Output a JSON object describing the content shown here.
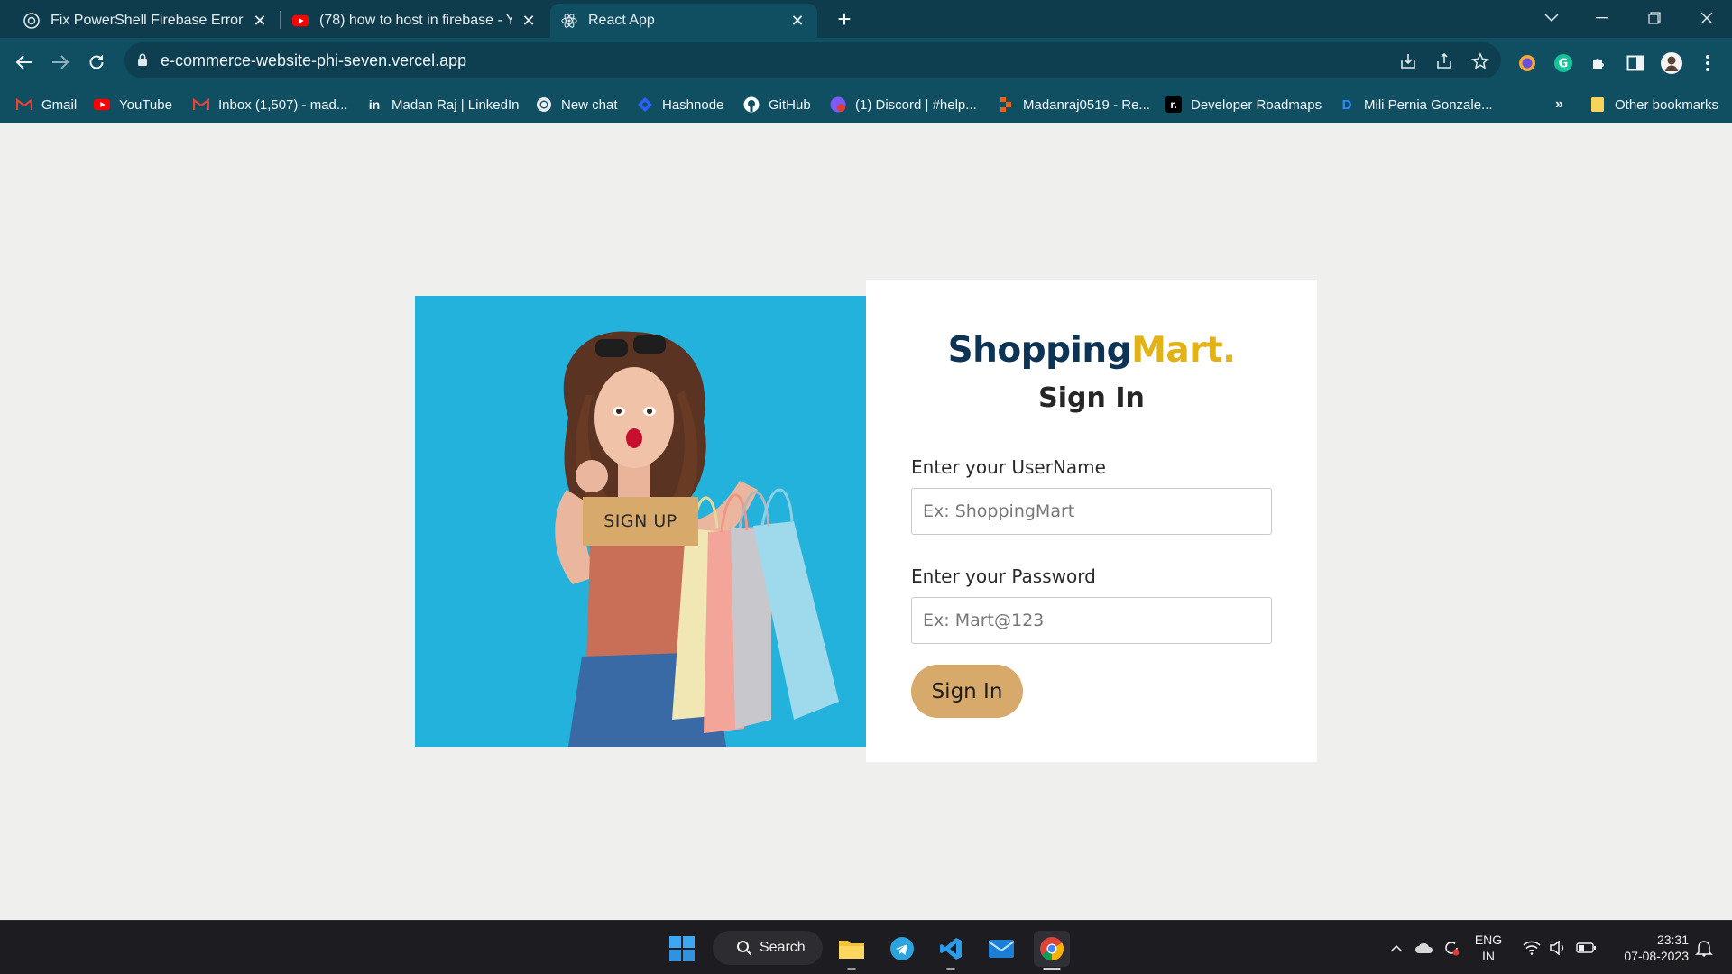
{
  "browser": {
    "tabs": [
      {
        "title": "Fix PowerShell Firebase Error",
        "icon": "chatgpt-icon"
      },
      {
        "title": "(78) how to host in firebase - YouTube",
        "icon": "youtube-icon"
      },
      {
        "title": "React App",
        "icon": "react-icon"
      }
    ],
    "url": "e-commerce-website-phi-seven.vercel.app",
    "bookmarks": [
      {
        "label": "Gmail",
        "icon": "gmail-icon"
      },
      {
        "label": "YouTube",
        "icon": "youtube-icon"
      },
      {
        "label": "Inbox (1,507) - mad...",
        "icon": "gmail-icon"
      },
      {
        "label": "Madan Raj | LinkedIn",
        "icon": "linkedin-icon"
      },
      {
        "label": "New chat",
        "icon": "chatgpt-icon"
      },
      {
        "label": "Hashnode",
        "icon": "hashnode-icon"
      },
      {
        "label": "GitHub",
        "icon": "github-icon"
      },
      {
        "label": "(1) Discord | #help...",
        "icon": "discord-icon"
      },
      {
        "label": "Madanraj0519 - Re...",
        "icon": "replit-icon"
      },
      {
        "label": "Developer Roadmaps",
        "icon": "roadmap-icon"
      },
      {
        "label": "Mili Pernia Gonzale...",
        "icon": "dribbble-icon"
      }
    ],
    "overflow_label": "»",
    "other_bookmarks": "Other bookmarks",
    "colors": {
      "frame": "#0f3c4c",
      "toolbar": "#104e62"
    }
  },
  "page": {
    "signup_label": "SIGN UP",
    "brand_part1": "Shopping",
    "brand_part2": "Mart.",
    "title": "Sign In",
    "username_label": "Enter your UserName",
    "username_placeholder": "Ex: ShoppingMart",
    "password_label": "Enter your Password",
    "password_placeholder": "Ex: Mart@123",
    "signin_label": "Sign In",
    "colors": {
      "brand_dark": "#0d3455",
      "brand_accent": "#e3b215",
      "button": "#d7aa6b",
      "photo_bg": "#22b2db"
    }
  },
  "taskbar": {
    "search_label": "Search",
    "apps": [
      "windows-start-icon",
      "file-explorer-icon",
      "telegram-icon",
      "vscode-icon",
      "mail-icon",
      "chrome-icon"
    ],
    "language_line1": "ENG",
    "language_line2": "IN",
    "time": "23:31",
    "date": "07-08-2023"
  }
}
